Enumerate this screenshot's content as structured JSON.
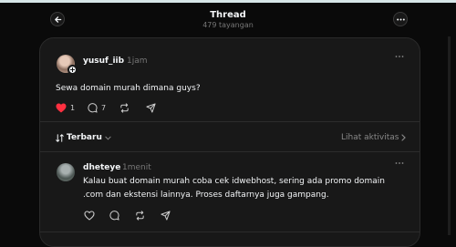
{
  "header": {
    "title": "Thread",
    "views": "479 tayangan"
  },
  "post": {
    "username": "yusuf_iib",
    "time": "1jam",
    "text": "Sewa domain murah dimana guys?",
    "likes": "1",
    "comments": "7",
    "liked": true
  },
  "sort": {
    "label": "Terbaru",
    "activity_label": "Lihat aktivitas"
  },
  "reply": {
    "username": "dheteye",
    "time": "1menit",
    "text": "Kalau buat domain murah coba cek idwebhost, sering ada promo domain .com dan ekstensi lainnya. Proses daftarnya juga gampang."
  },
  "colors": {
    "background": "#0a0a0a",
    "card": "#181818",
    "like": "#ff3040",
    "muted": "#777777"
  },
  "icons": [
    "back-arrow-icon",
    "more-icon",
    "heart-icon",
    "comment-icon",
    "repost-icon",
    "share-icon",
    "sort-icon",
    "chevron-down-icon",
    "chevron-right-icon"
  ]
}
